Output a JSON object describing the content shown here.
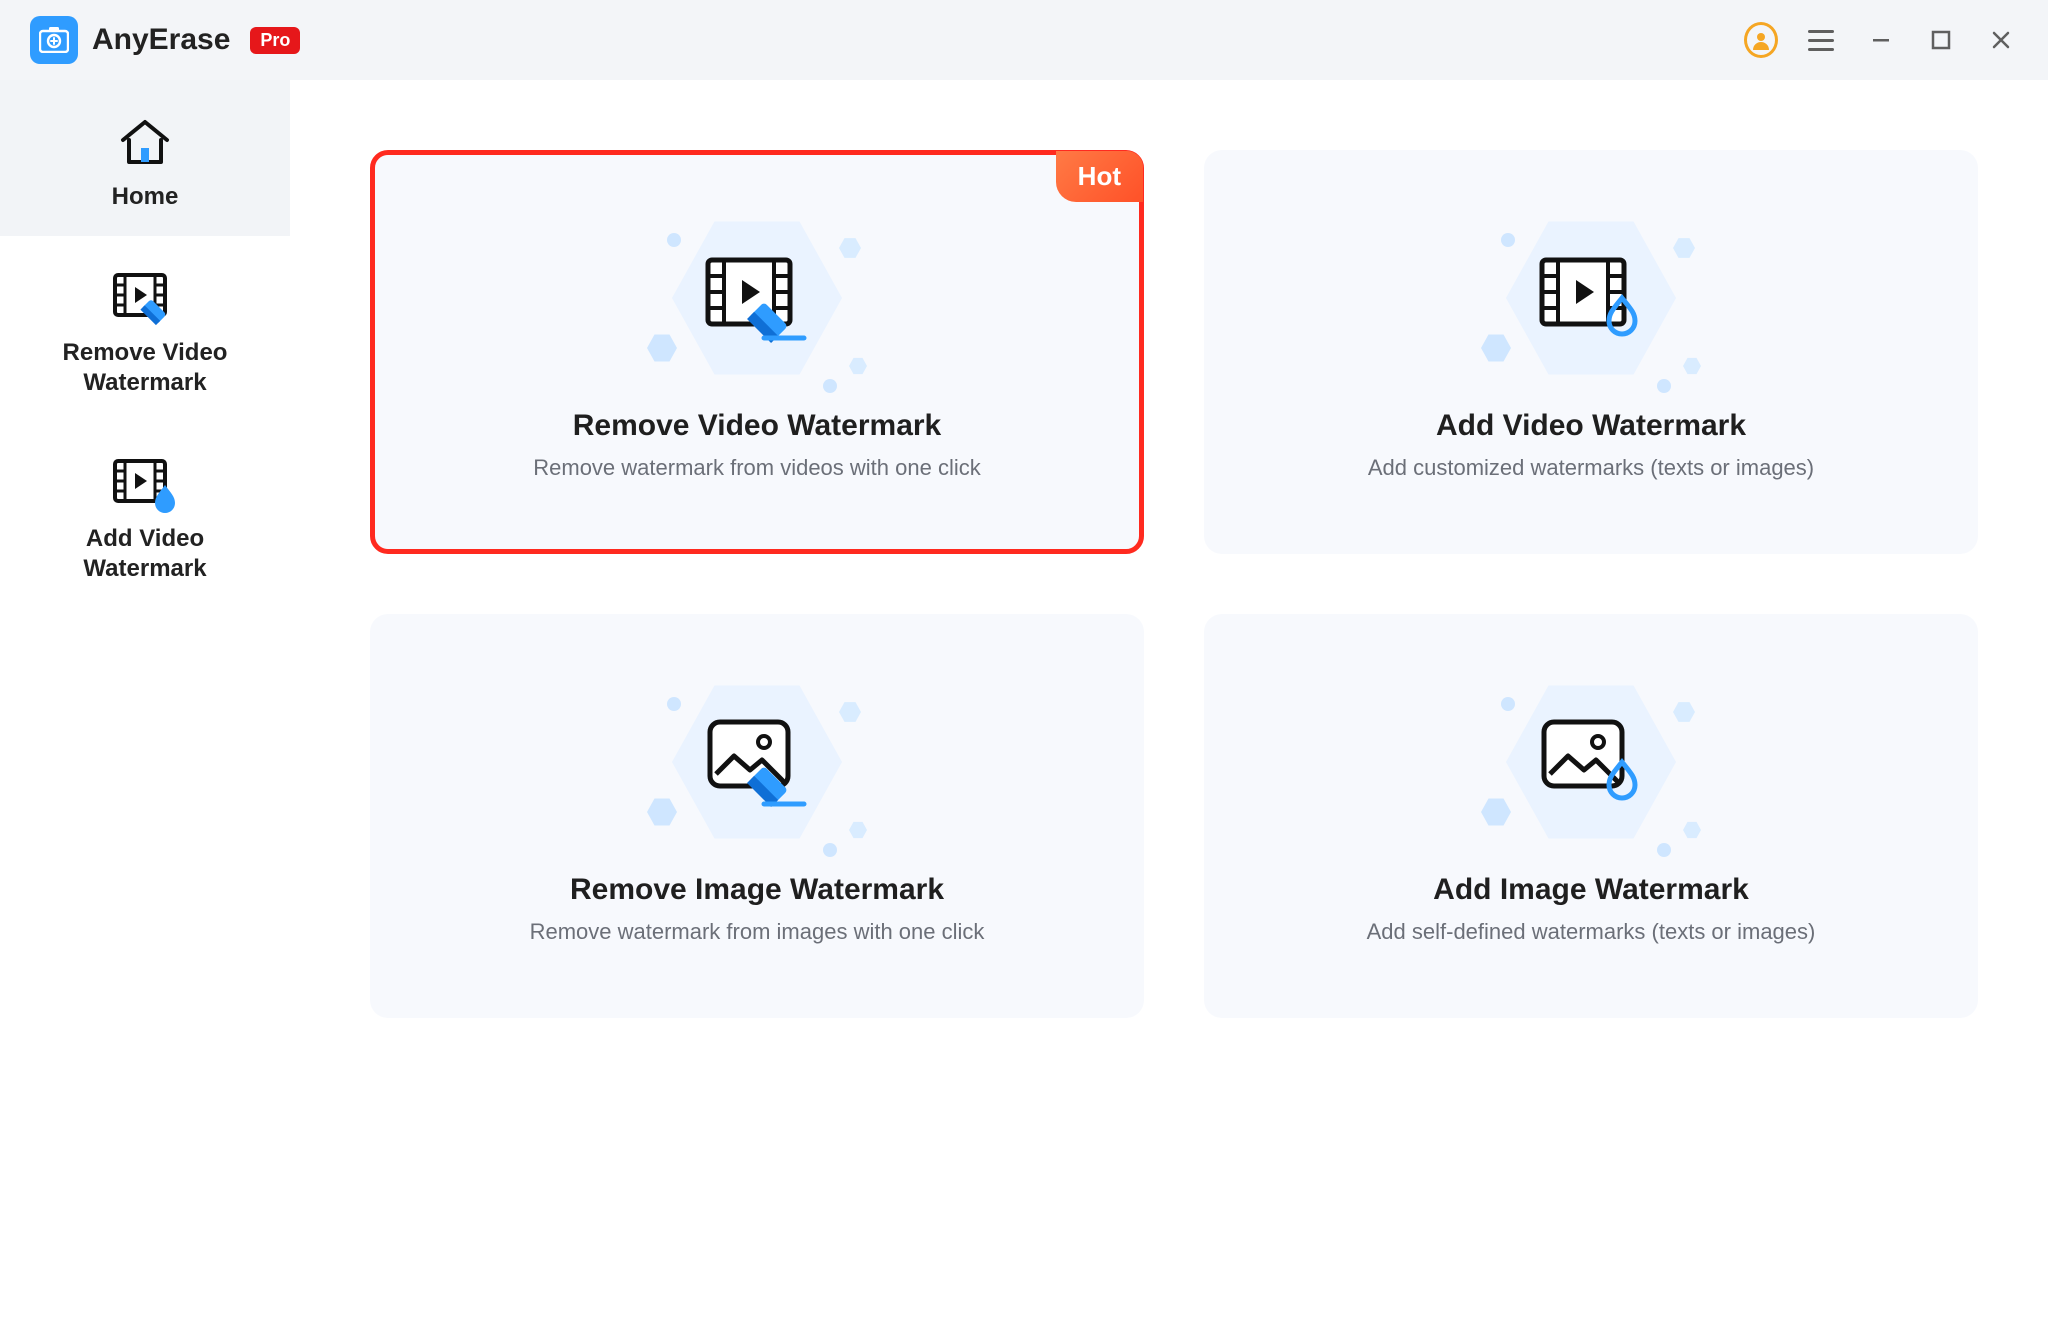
{
  "app": {
    "name": "AnyErase",
    "edition": "Pro"
  },
  "sidebar": {
    "items": [
      {
        "label": "Home"
      },
      {
        "label": "Remove Video\nWatermark"
      },
      {
        "label": "Add Video\nWatermark"
      }
    ]
  },
  "cards": [
    {
      "title": "Remove Video Watermark",
      "desc": "Remove watermark from videos with one click",
      "badge": "Hot"
    },
    {
      "title": "Add Video Watermark",
      "desc": "Add customized watermarks (texts or images)"
    },
    {
      "title": "Remove Image Watermark",
      "desc": "Remove watermark from images with one click"
    },
    {
      "title": "Add Image Watermark",
      "desc": "Add self-defined watermarks  (texts or images)"
    }
  ]
}
